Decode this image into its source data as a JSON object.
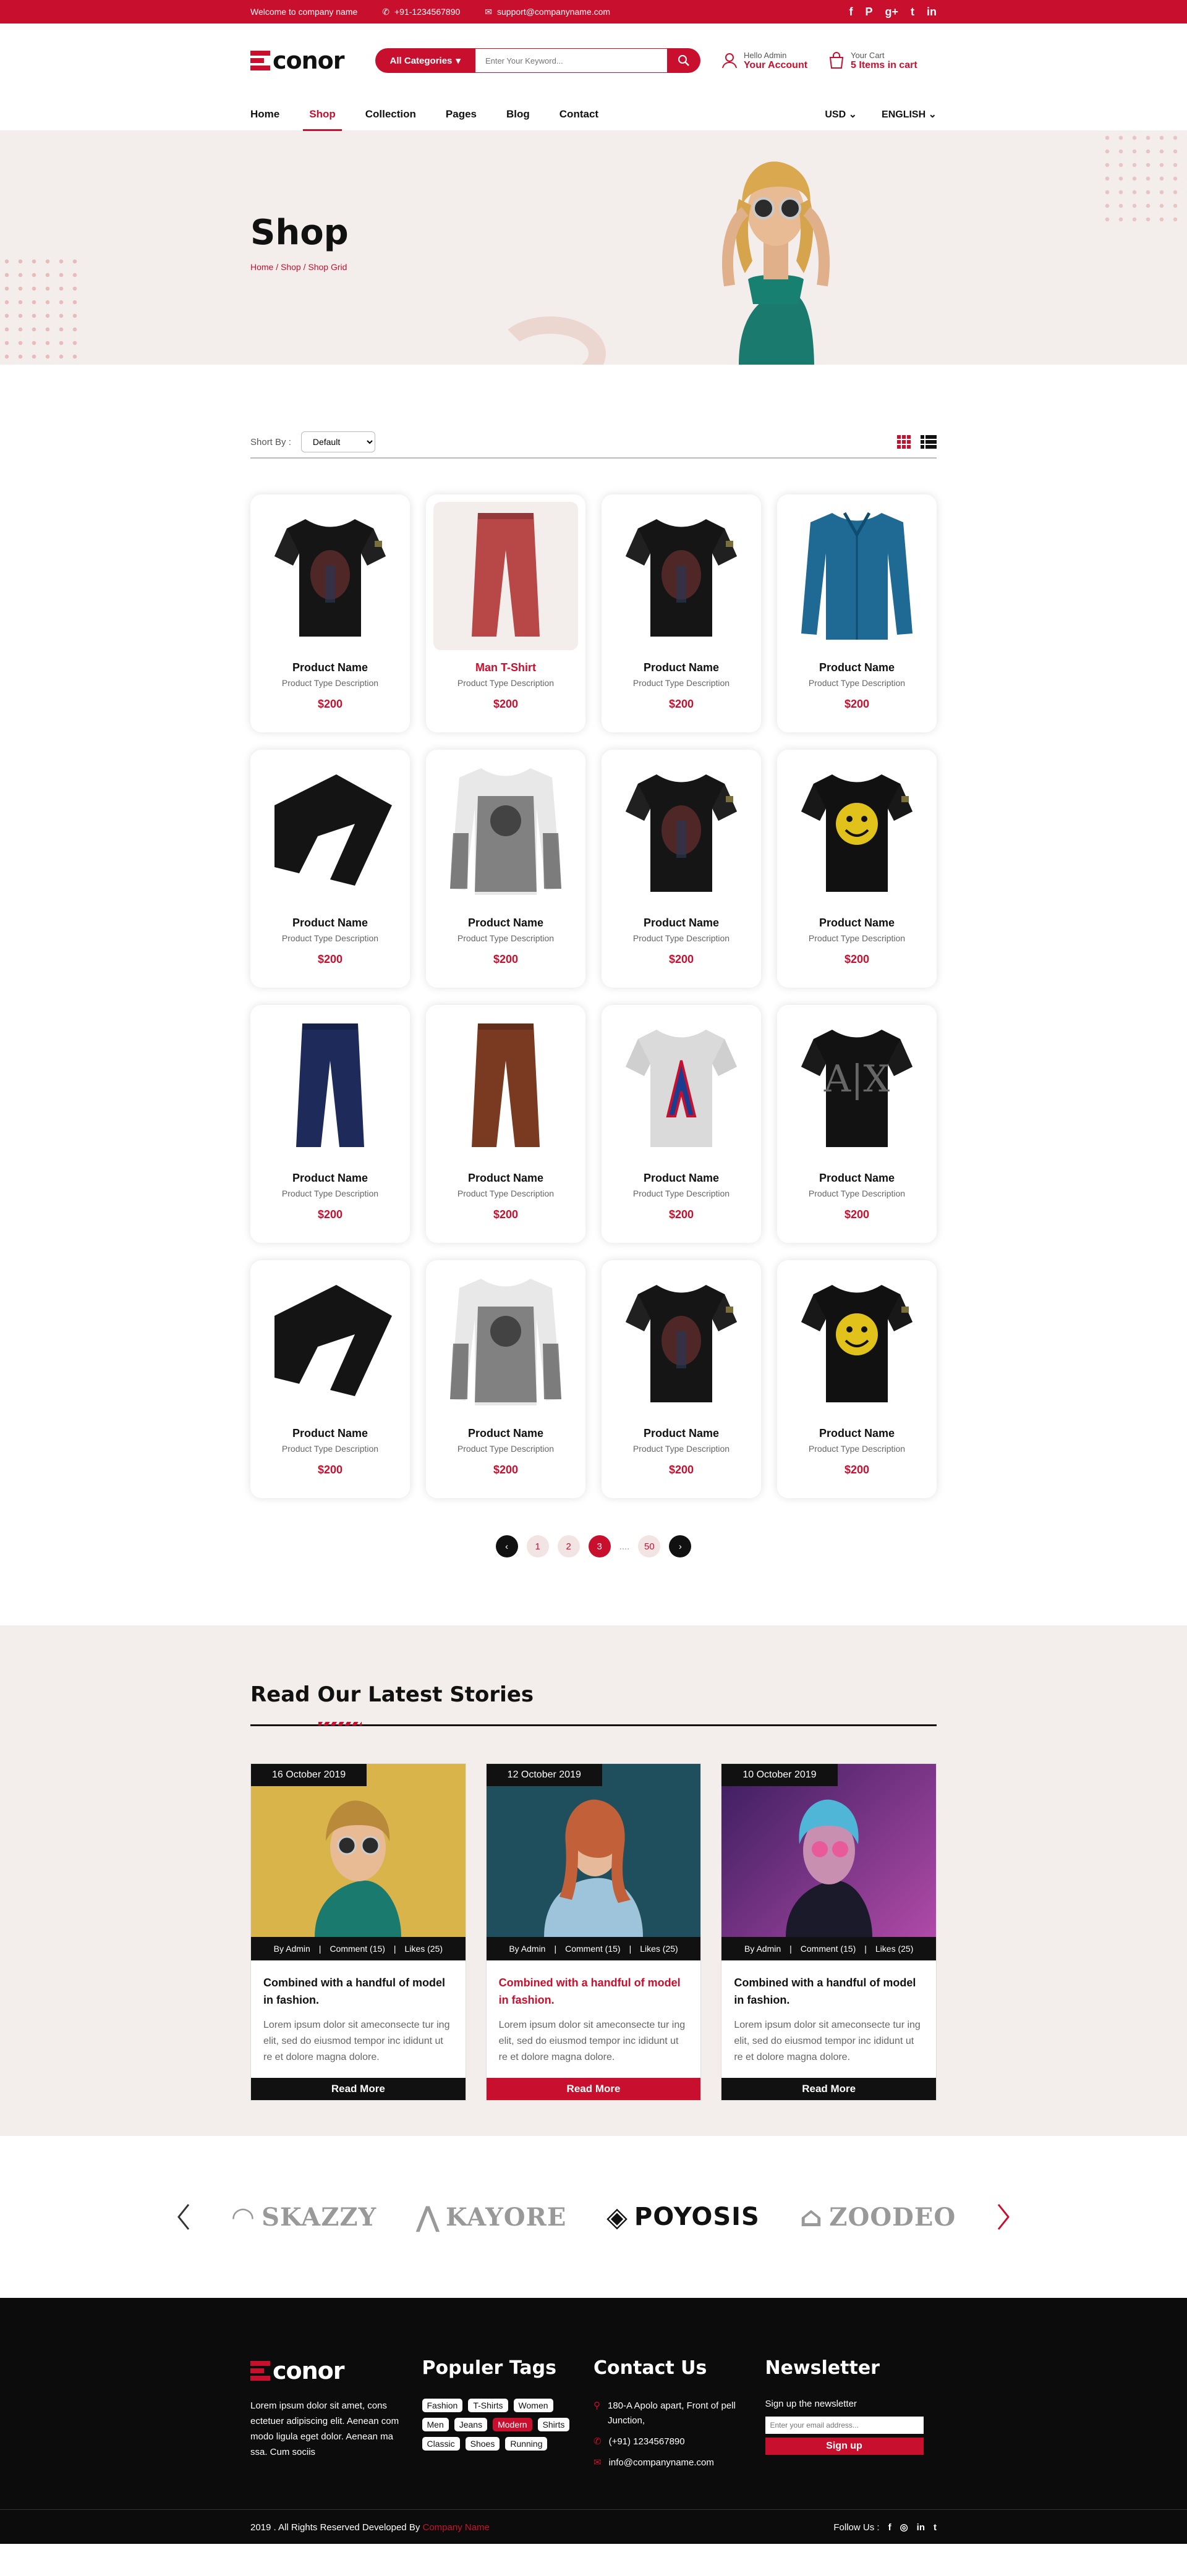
{
  "topbar": {
    "welcome": "Welcome to company name",
    "phone": "+91-1234567890",
    "email": "support@companyname.com"
  },
  "brand": {
    "logo_text": "conor"
  },
  "search": {
    "category": "All Categories",
    "placeholder": "Enter Your Keyword..."
  },
  "account": {
    "hello": "Hello Admin",
    "label": "Your Account"
  },
  "cart": {
    "label": "Your Cart",
    "count": "5 Items in cart"
  },
  "nav": {
    "items": [
      "Home",
      "Shop",
      "Collection",
      "Pages",
      "Blog",
      "Contact"
    ],
    "active": "Shop",
    "currency": "USD",
    "language": "ENGLISH"
  },
  "hero": {
    "title": "Shop",
    "breadcrumb": "Home / Shop / Shop Grid"
  },
  "toolbar": {
    "sort_label": "Short By :",
    "sort_value": "Default"
  },
  "products": [
    {
      "name": "Product Name",
      "desc": "Product Type Description",
      "price": "$200",
      "icon": "black-skull-tshirt"
    },
    {
      "name": "Man T-Shirt",
      "desc": "Product Type Description",
      "price": "$200",
      "icon": "red-pants",
      "highlight": true
    },
    {
      "name": "Product Name",
      "desc": "Product Type Description",
      "price": "$200",
      "icon": "black-skull-tshirt"
    },
    {
      "name": "Product Name",
      "desc": "Product Type Description",
      "price": "$200",
      "icon": "blue-shirt"
    },
    {
      "name": "Product Name",
      "desc": "Product Type Description",
      "price": "$200",
      "icon": "black-pants"
    },
    {
      "name": "Product Name",
      "desc": "Product Type Description",
      "price": "$200",
      "icon": "printed-longsleeve"
    },
    {
      "name": "Product Name",
      "desc": "Product Type Description",
      "price": "$200",
      "icon": "black-skull-tshirt"
    },
    {
      "name": "Product Name",
      "desc": "Product Type Description",
      "price": "$200",
      "icon": "smiley-tshirt"
    },
    {
      "name": "Product Name",
      "desc": "Product Type Description",
      "price": "$200",
      "icon": "navy-pants"
    },
    {
      "name": "Product Name",
      "desc": "Product Type Description",
      "price": "$200",
      "icon": "brown-pants"
    },
    {
      "name": "Product Name",
      "desc": "Product Type Description",
      "price": "$200",
      "icon": "grey-tshirt"
    },
    {
      "name": "Product Name",
      "desc": "Product Type Description",
      "price": "$200",
      "icon": "black-ax-tshirt"
    },
    {
      "name": "Product Name",
      "desc": "Product Type Description",
      "price": "$200",
      "icon": "black-pants"
    },
    {
      "name": "Product Name",
      "desc": "Product Type Description",
      "price": "$200",
      "icon": "printed-longsleeve"
    },
    {
      "name": "Product Name",
      "desc": "Product Type Description",
      "price": "$200",
      "icon": "black-skull-tshirt"
    },
    {
      "name": "Product Name",
      "desc": "Product Type Description",
      "price": "$200",
      "icon": "smiley-tshirt"
    }
  ],
  "pagination": {
    "pages": [
      "1",
      "2",
      "3"
    ],
    "current": "3",
    "ellipsis": "....",
    "last": "50"
  },
  "stories": {
    "title": "Read Our Latest Stories",
    "posts": [
      {
        "date": "16 October 2019",
        "author": "By Admin",
        "comments": "Comment (15)",
        "likes": "Likes (25)",
        "title": "Combined with a handful of model in fashion.",
        "text": "Lorem ipsum dolor sit ameconsecte tur ing elit, sed do eiusmod tempor inc ididunt ut re et dolore magna dolore.",
        "more": "Read More"
      },
      {
        "date": "12 October 2019",
        "author": "By Admin",
        "comments": "Comment (15)",
        "likes": "Likes (25)",
        "title": "Combined with a handful of model in fashion.",
        "text": "Lorem ipsum dolor sit ameconsecte tur ing elit, sed do eiusmod tempor inc ididunt ut re et dolore magna dolore.",
        "more": "Read More",
        "active": true
      },
      {
        "date": "10 October 2019",
        "author": "By Admin",
        "comments": "Comment (15)",
        "likes": "Likes (25)",
        "title": "Combined with a handful of model in fashion.",
        "text": "Lorem ipsum dolor sit ameconsecte tur ing elit, sed do eiusmod tempor inc ididunt ut re et dolore magna dolore.",
        "more": "Read More"
      }
    ]
  },
  "brands": [
    "SKAZZY",
    "KAYORE",
    "POYOSIS",
    "ZOODEO"
  ],
  "footer": {
    "about": "Lorem ipsum dolor sit amet, cons ectetuer adipiscing elit. Aenean com modo ligula eget dolor. Aenean ma ssa. Cum sociis",
    "tags_title": "Populer Tags",
    "tags": [
      "Fashion",
      "T-Shirts",
      "Women",
      "Men",
      "Jeans",
      "Modern",
      "Shirts",
      "Classic",
      "Shoes",
      "Running"
    ],
    "active_tag": "Modern",
    "contact_title": "Contact Us",
    "address": "180-A Apolo apart, Front of pell Junction,",
    "phone": "(+91) 1234567890",
    "email": "info@companyname.com",
    "newsletter_title": "Newsletter",
    "newsletter_text": "Sign up the newsletter",
    "newsletter_placeholder": "Enter your email address...",
    "signup": "Sign up",
    "copyright": "2019 . All Rights Reserved Developed By",
    "developer": "Company Name",
    "follow": "Follow Us :"
  },
  "colors": {
    "accent": "#c8102e",
    "dark": "#111111",
    "light_bg": "#f3eeec"
  }
}
